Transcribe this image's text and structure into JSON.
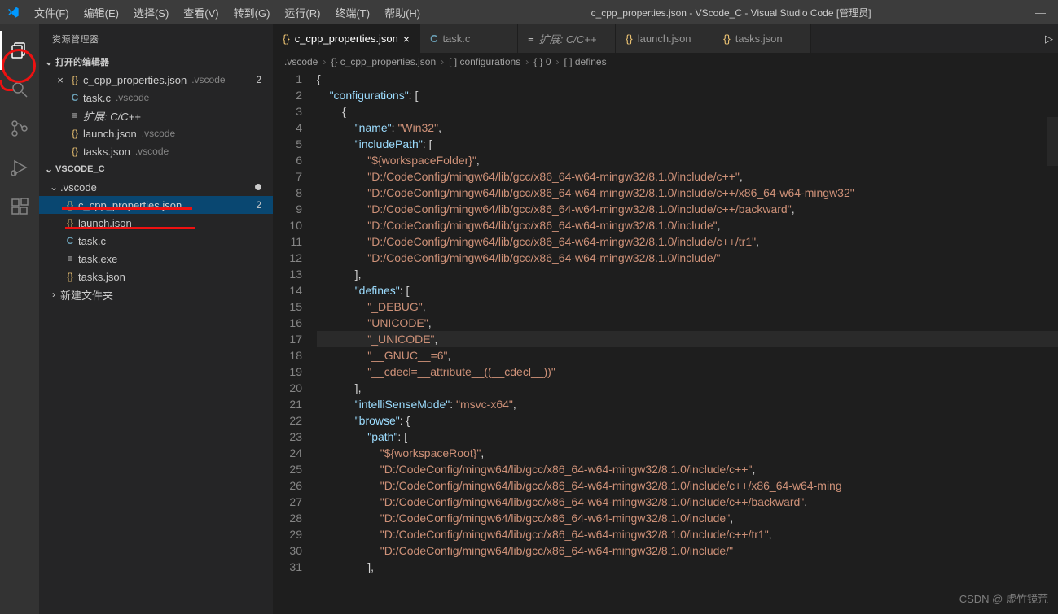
{
  "titlebar": {
    "menu": [
      "文件(F)",
      "编辑(E)",
      "选择(S)",
      "查看(V)",
      "转到(G)",
      "运行(R)",
      "终端(T)",
      "帮助(H)"
    ],
    "title": "c_cpp_properties.json - VScode_C - Visual Studio Code [管理员]"
  },
  "sidebar": {
    "title": "资源管理器",
    "openEditors": {
      "label": "打开的编辑器",
      "items": [
        {
          "icon": "{}",
          "iconClass": "icon-json",
          "name": "c_cpp_properties.json",
          "path": ".vscode",
          "badge": "2",
          "close": true
        },
        {
          "icon": "C",
          "iconClass": "icon-c",
          "name": "task.c",
          "path": ".vscode"
        },
        {
          "icon": "≡",
          "iconClass": "icon-ext",
          "name": "扩展: C/C++",
          "path": "",
          "italic": true
        },
        {
          "icon": "{}",
          "iconClass": "icon-json",
          "name": "launch.json",
          "path": ".vscode"
        },
        {
          "icon": "{}",
          "iconClass": "icon-json",
          "name": "tasks.json",
          "path": ".vscode"
        }
      ]
    },
    "workspace": {
      "label": "VSCODE_C",
      "folders": [
        {
          "type": "folder",
          "name": ".vscode",
          "modified": true,
          "expanded": true,
          "children": [
            {
              "icon": "{}",
              "iconClass": "icon-json",
              "name": "c_cpp_properties.json",
              "badge": "2",
              "selected": true
            },
            {
              "icon": "{}",
              "iconClass": "icon-json",
              "name": "launch.json"
            },
            {
              "icon": "C",
              "iconClass": "icon-c",
              "name": "task.c"
            },
            {
              "icon": "≡",
              "iconClass": "icon-ext",
              "name": "task.exe"
            },
            {
              "icon": "{}",
              "iconClass": "icon-json",
              "name": "tasks.json"
            }
          ]
        },
        {
          "type": "folder",
          "name": "新建文件夹",
          "expanded": false
        }
      ]
    }
  },
  "tabs": [
    {
      "icon": "{}",
      "iconClass": "icon-json",
      "label": "c_cpp_properties.json",
      "active": true,
      "close": "×"
    },
    {
      "icon": "C",
      "iconClass": "icon-c",
      "label": "task.c"
    },
    {
      "icon": "≡",
      "iconClass": "icon-ext",
      "label": "扩展: C/C++",
      "italic": true
    },
    {
      "icon": "{}",
      "iconClass": "icon-json",
      "label": "launch.json"
    },
    {
      "icon": "{}",
      "iconClass": "icon-json",
      "label": "tasks.json"
    }
  ],
  "breadcrumb": [
    ".vscode",
    "{} c_cpp_properties.json",
    "[ ] configurations",
    "{ } 0",
    "[ ] defines"
  ],
  "code": {
    "lines": [
      [
        [
          "{",
          "brace"
        ]
      ],
      [
        [
          "    ",
          ""
        ],
        [
          "\"configurations\"",
          "key"
        ],
        [
          ": [",
          "punct"
        ]
      ],
      [
        [
          "        {",
          "brace"
        ]
      ],
      [
        [
          "            ",
          ""
        ],
        [
          "\"name\"",
          "key"
        ],
        [
          ": ",
          "punct"
        ],
        [
          "\"Win32\"",
          "str"
        ],
        [
          ",",
          "punct"
        ]
      ],
      [
        [
          "            ",
          ""
        ],
        [
          "\"includePath\"",
          "key"
        ],
        [
          ": [",
          "punct"
        ]
      ],
      [
        [
          "                ",
          ""
        ],
        [
          "\"${workspaceFolder}\"",
          "str"
        ],
        [
          ",",
          "punct"
        ]
      ],
      [
        [
          "                ",
          ""
        ],
        [
          "\"D:/CodeConfig/mingw64/lib/gcc/x86_64-w64-mingw32/8.1.0/include/c++\"",
          "str"
        ],
        [
          ",",
          "punct"
        ]
      ],
      [
        [
          "                ",
          ""
        ],
        [
          "\"D:/CodeConfig/mingw64/lib/gcc/x86_64-w64-mingw32/8.1.0/include/c++/x86_64-w64-mingw32\"",
          "str"
        ]
      ],
      [
        [
          "                ",
          ""
        ],
        [
          "\"D:/CodeConfig/mingw64/lib/gcc/x86_64-w64-mingw32/8.1.0/include/c++/backward\"",
          "str"
        ],
        [
          ",",
          "punct"
        ]
      ],
      [
        [
          "                ",
          ""
        ],
        [
          "\"D:/CodeConfig/mingw64/lib/gcc/x86_64-w64-mingw32/8.1.0/include\"",
          "str"
        ],
        [
          ",",
          "punct"
        ]
      ],
      [
        [
          "                ",
          ""
        ],
        [
          "\"D:/CodeConfig/mingw64/lib/gcc/x86_64-w64-mingw32/8.1.0/include/c++/tr1\"",
          "str"
        ],
        [
          ",",
          "punct"
        ]
      ],
      [
        [
          "                ",
          ""
        ],
        [
          "\"D:/CodeConfig/mingw64/lib/gcc/x86_64-w64-mingw32/8.1.0/include/\"",
          "str"
        ]
      ],
      [
        [
          "            ],",
          "punct"
        ]
      ],
      [
        [
          "            ",
          ""
        ],
        [
          "\"defines\"",
          "key"
        ],
        [
          ": [",
          "punct"
        ]
      ],
      [
        [
          "                ",
          ""
        ],
        [
          "\"_DEBUG\"",
          "str"
        ],
        [
          ",",
          "punct"
        ]
      ],
      [
        [
          "                ",
          ""
        ],
        [
          "\"UNICODE\"",
          "str"
        ],
        [
          ",",
          "punct"
        ]
      ],
      [
        [
          "                ",
          ""
        ],
        [
          "\"_UNICODE\"",
          "str"
        ],
        [
          ",",
          "punct"
        ]
      ],
      [
        [
          "                ",
          ""
        ],
        [
          "\"__GNUC__=6\"",
          "str"
        ],
        [
          ",",
          "punct"
        ]
      ],
      [
        [
          "                ",
          ""
        ],
        [
          "\"__cdecl=__attribute__((__cdecl__))\"",
          "str"
        ]
      ],
      [
        [
          "            ],",
          "punct"
        ]
      ],
      [
        [
          "            ",
          ""
        ],
        [
          "\"intelliSenseMode\"",
          "key"
        ],
        [
          ": ",
          "punct"
        ],
        [
          "\"msvc-x64\"",
          "str"
        ],
        [
          ",",
          "punct"
        ]
      ],
      [
        [
          "            ",
          ""
        ],
        [
          "\"browse\"",
          "key"
        ],
        [
          ": {",
          "punct"
        ]
      ],
      [
        [
          "                ",
          ""
        ],
        [
          "\"path\"",
          "key"
        ],
        [
          ": [",
          "punct"
        ]
      ],
      [
        [
          "                    ",
          ""
        ],
        [
          "\"${workspaceRoot}\"",
          "str"
        ],
        [
          ",",
          "punct"
        ]
      ],
      [
        [
          "                    ",
          ""
        ],
        [
          "\"D:/CodeConfig/mingw64/lib/gcc/x86_64-w64-mingw32/8.1.0/include/c++\"",
          "str"
        ],
        [
          ",",
          "punct"
        ]
      ],
      [
        [
          "                    ",
          ""
        ],
        [
          "\"D:/CodeConfig/mingw64/lib/gcc/x86_64-w64-mingw32/8.1.0/include/c++/x86_64-w64-ming",
          "str"
        ]
      ],
      [
        [
          "                    ",
          ""
        ],
        [
          "\"D:/CodeConfig/mingw64/lib/gcc/x86_64-w64-mingw32/8.1.0/include/c++/backward\"",
          "str"
        ],
        [
          ",",
          "punct"
        ]
      ],
      [
        [
          "                    ",
          ""
        ],
        [
          "\"D:/CodeConfig/mingw64/lib/gcc/x86_64-w64-mingw32/8.1.0/include\"",
          "str"
        ],
        [
          ",",
          "punct"
        ]
      ],
      [
        [
          "                    ",
          ""
        ],
        [
          "\"D:/CodeConfig/mingw64/lib/gcc/x86_64-w64-mingw32/8.1.0/include/c++/tr1\"",
          "str"
        ],
        [
          ",",
          "punct"
        ]
      ],
      [
        [
          "                    ",
          ""
        ],
        [
          "\"D:/CodeConfig/mingw64/lib/gcc/x86_64-w64-mingw32/8.1.0/include/\"",
          "str"
        ]
      ],
      [
        [
          "                ],",
          "punct"
        ]
      ]
    ]
  },
  "watermark": "CSDN @ 虚竹镜荒"
}
